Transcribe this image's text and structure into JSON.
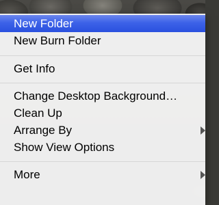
{
  "context_menu": {
    "items": [
      {
        "label": "New Folder",
        "selected": true,
        "submenu": false
      },
      {
        "label": "New Burn Folder",
        "selected": false,
        "submenu": false
      },
      {
        "label": "Get Info",
        "selected": false,
        "submenu": false
      },
      {
        "label": "Change Desktop Background…",
        "selected": false,
        "submenu": false
      },
      {
        "label": "Clean Up",
        "selected": false,
        "submenu": false
      },
      {
        "label": "Arrange By",
        "selected": false,
        "submenu": true
      },
      {
        "label": "Show View Options",
        "selected": false,
        "submenu": false
      },
      {
        "label": "More",
        "selected": false,
        "submenu": true
      }
    ],
    "selection_color": "#3d62e8"
  }
}
